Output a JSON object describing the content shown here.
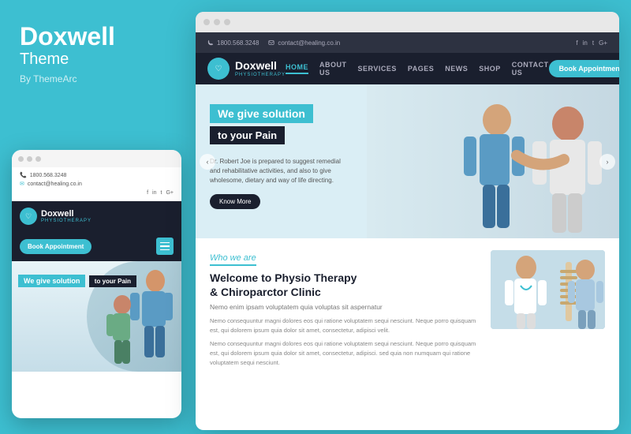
{
  "left": {
    "brand": {
      "title": "Doxwell",
      "subtitle": "Theme",
      "by": "By ThemeArc"
    }
  },
  "mobile": {
    "phone": "1800.568.3248",
    "email": "contact@healing.co.in",
    "logo": "Doxwell",
    "logo_sub": "PHYSIOTHERAPY",
    "book_btn": "Book Appointment",
    "hero_line1": "We give solution",
    "hero_line2": "to your Pain"
  },
  "desktop": {
    "topbar": {
      "phone": "1800.568.3248",
      "email": "contact@healing.co.in"
    },
    "nav": {
      "logo": "Doxwell",
      "logo_sub": "PHYSIOTHERAPY",
      "items": [
        "HOME",
        "ABOUT US",
        "SERVICES",
        "PAGES",
        "NEWS",
        "SHOP",
        "CONTACT US"
      ],
      "book_btn": "Book Appointment"
    },
    "hero": {
      "line1": "We give solution",
      "line2": "to your Pain",
      "desc_line1": "Dr. Robert Joe is prepared to suggest remedial",
      "desc_line2": "and rehabilitative activities, and also to give",
      "desc_line3": "wholesome, dietary and way of life directing.",
      "know_more": "Know More"
    },
    "who": {
      "label": "Who we are",
      "title_line1": "Welcome to Physio Therapy",
      "title_line2": "& Chiroparctor Clinic",
      "subtitle": "Nemo enim ipsam voluptatem quia voluptas sit aspernatur",
      "para1": "Nemo consequuntur magni dolores eos qui ratione voluptatem sequi nesciunt. Neque porro quisquam est, qui dolorem ipsum quia dolor sit amet, consectetur, adipisci velit.",
      "para2": "Nemo consequuntur magni dolores eos qui ratione voluptatem sequi nesciunt. Neque porro quisquam est, qui dolorem ipsum quia dolor sit amet, consectetur, adipisci. sed quia non numquam qui ratione voluptatem sequi nesciunt."
    }
  },
  "icons": {
    "phone": "📞",
    "email": "✉",
    "facebook": "f",
    "linkedin": "in",
    "twitter": "t",
    "googleplus": "G+"
  }
}
